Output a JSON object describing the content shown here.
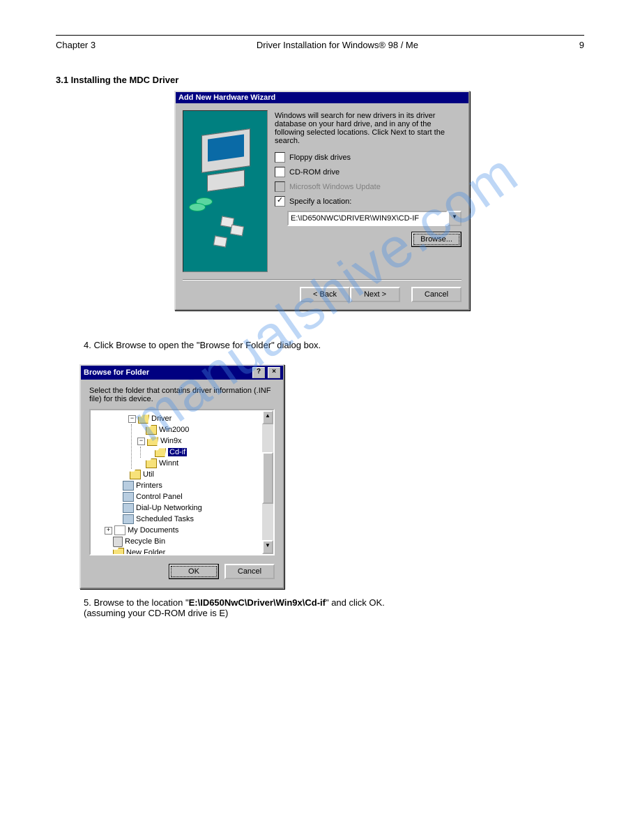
{
  "page": {
    "chapter": "Chapter 3",
    "title": "Driver Installation for Windows® 98 / Me",
    "number": "9"
  },
  "section_heading": "3.1 Installing the MDC Driver",
  "wizard": {
    "title": "Add New Hardware Wizard",
    "intro": "Windows will search for new drivers in its driver database on your hard drive, and in any of the following selected locations. Click Next to start the search.",
    "opt_floppy": "Floppy disk drives",
    "opt_cdrom": "CD-ROM drive",
    "opt_winupdate": "Microsoft Windows Update",
    "opt_specify": "Specify a location:",
    "location_value": "E:\\ID650NWC\\DRIVER\\WIN9X\\CD-IF",
    "browse": "Browse...",
    "back": "< Back",
    "next": "Next >",
    "cancel": "Cancel"
  },
  "step4": "4. Click Browse to open the \"Browse for Folder\" dialog box.",
  "browse_dialog": {
    "title": "Browse for Folder",
    "prompt": "Select the folder that contains driver information (.INF file) for this device.",
    "items": {
      "driver": "Driver",
      "win2000": "Win2000",
      "win9x": "Win9x",
      "cdif": "Cd-if",
      "winnt": "Winnt",
      "util": "Util",
      "printers": "Printers",
      "control_panel": "Control Panel",
      "dialup": "Dial-Up Networking",
      "scheduled": "Scheduled Tasks",
      "mydocs": "My Documents",
      "recycle": "Recycle Bin",
      "newfolder": "New Folder"
    },
    "ok": "OK",
    "cancel": "Cancel"
  },
  "step5_a": "5. Browse to the location \"",
  "step5_path": "E:\\ID650NwC\\Driver\\Win9x\\Cd-if",
  "step5_b": "\" and click OK.",
  "step5_note": "(assuming your CD-ROM drive is E)",
  "watermark": "manualshive.com"
}
